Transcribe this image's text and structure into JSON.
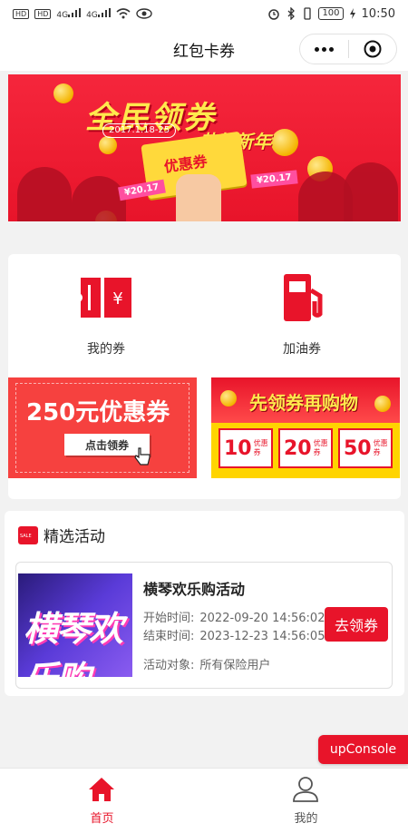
{
  "status_bar": {
    "hd1": "HD",
    "hd2": "HD",
    "signal1": "4G",
    "signal2": "4G",
    "battery": "100",
    "time": "10:50"
  },
  "title_bar": {
    "title": "红包卡券"
  },
  "banner": {
    "headline": "全民领券",
    "subline": "恭贺新年",
    "date": "2017.1.18-25",
    "coupon_text": "优惠券",
    "ticket_left": "¥20.17",
    "ticket_right": "¥20.17"
  },
  "categories": [
    {
      "label": "我的券",
      "icon": "coupon-icon"
    },
    {
      "label": "加油券",
      "icon": "gas-pump-icon"
    }
  ],
  "promos": {
    "left": {
      "amount_text": "250元优惠券",
      "button": "点击领券"
    },
    "right": {
      "title": "先领券再购物",
      "coupons": [
        {
          "value": "10",
          "text": "优惠券"
        },
        {
          "value": "20",
          "text": "优惠券"
        },
        {
          "value": "50",
          "text": "优惠券"
        }
      ]
    }
  },
  "activities": {
    "section_title": "精选活动",
    "sale_tag": "SALE",
    "items": [
      {
        "name": "横琴欢乐购活动",
        "thumb_text": "横琴欢乐购",
        "start_label": "开始时间:",
        "start_value": "2022-09-20 14:56:02",
        "end_label": "结束时间:",
        "end_value": "2023-12-23 14:56:05",
        "target_label": "活动对象:",
        "target_value": "所有保险用户",
        "button": "去领券"
      }
    ]
  },
  "console_button": "upConsole",
  "tabs": [
    {
      "label": "首页",
      "icon": "home-icon",
      "active": true
    },
    {
      "label": "我的",
      "icon": "user-icon",
      "active": false
    }
  ],
  "colors": {
    "brand_red": "#e8142a",
    "active_tab": "#e8142a",
    "inactive_tab": "#555555"
  }
}
